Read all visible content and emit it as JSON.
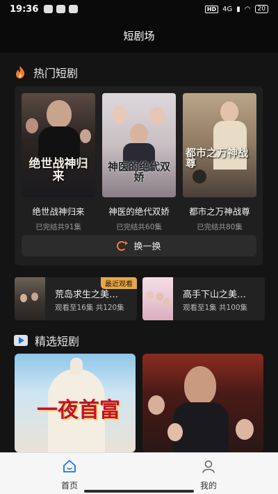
{
  "status": {
    "time": "19:36",
    "network": "4G",
    "battery": "20"
  },
  "header": {
    "title": "短剧场"
  },
  "hot": {
    "title": "热门短剧",
    "items": [
      {
        "title": "绝世战神归来",
        "sub": "已完结共91集",
        "poster_text": "绝世战神归来"
      },
      {
        "title": "神医的绝代双娇",
        "sub": "已完结共60集",
        "poster_text": "神医的绝代双娇"
      },
      {
        "title": "都市之万神战尊",
        "sub": "已完结共80集",
        "poster_text": "都市之万神战尊"
      }
    ],
    "refresh_label": "换一换"
  },
  "recent": [
    {
      "title": "荒岛求生之美…",
      "sub": "观看至16集 共120集",
      "badge": "最近观看"
    },
    {
      "title": "高手下山之美…",
      "sub": "观看至1集 共100集"
    }
  ],
  "featured": {
    "title": "精选短剧",
    "items": [
      {
        "poster_text": "一夜首富"
      },
      {
        "poster_text": ""
      }
    ]
  },
  "tabs": {
    "home": "首页",
    "mine": "我的"
  },
  "colors": {
    "accent": "#f07a3a",
    "tab_active": "#1a73e8",
    "badge": "#e9a64a"
  }
}
